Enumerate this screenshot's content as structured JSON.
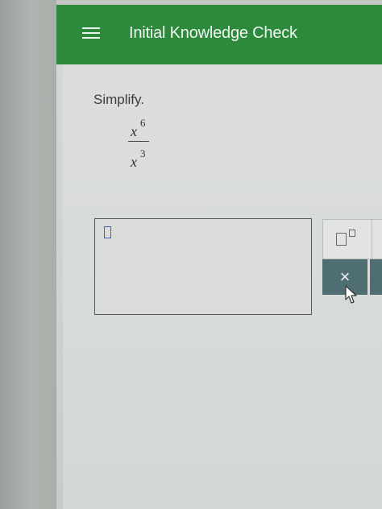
{
  "header": {
    "title": "Initial Knowledge Check",
    "menu_icon": "hamburger-menu-icon",
    "bg_color": "#2d8a3c"
  },
  "question": {
    "instruction": "Simplify.",
    "numerator_base": "x",
    "numerator_exponent": "6",
    "denominator_base": "x",
    "denominator_exponent": "3"
  },
  "answer": {
    "value": ""
  },
  "tools": {
    "superscript_icon": "superscript-template-icon",
    "clear_label": "×",
    "clear_color": "#4f6e74"
  }
}
